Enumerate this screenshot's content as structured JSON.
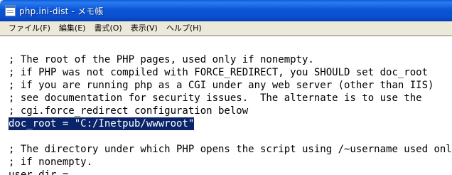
{
  "window": {
    "title": "php.ini-dist - メモ帳"
  },
  "menu": {
    "items": [
      {
        "label": "ファイル(F)"
      },
      {
        "label": "編集(E)"
      },
      {
        "label": "書式(O)"
      },
      {
        "label": "表示(V)"
      },
      {
        "label": "ヘルプ(H)"
      }
    ]
  },
  "editor": {
    "lines": [
      "; The root of the PHP pages, used only if nonempty.",
      "; if PHP was not compiled with FORCE_REDIRECT, you SHOULD set doc_root",
      "; if you are running php as a CGI under any web server (other than IIS)",
      "; see documentation for security issues.  The alternate is to use the",
      "; cgi.force_redirect configuration below",
      "doc_root = \"C:/Inetpub/wwwroot\"",
      "",
      "; The directory under which PHP opens the script using /~username used only",
      "; if nonempty.",
      "user_dir ="
    ],
    "selected_line": "doc_root = \"C:/Inetpub/wwwroot\""
  },
  "colors": {
    "titlebar": "#0a55d7",
    "selection": "#0a246a",
    "menubar": "#ece9d8"
  }
}
